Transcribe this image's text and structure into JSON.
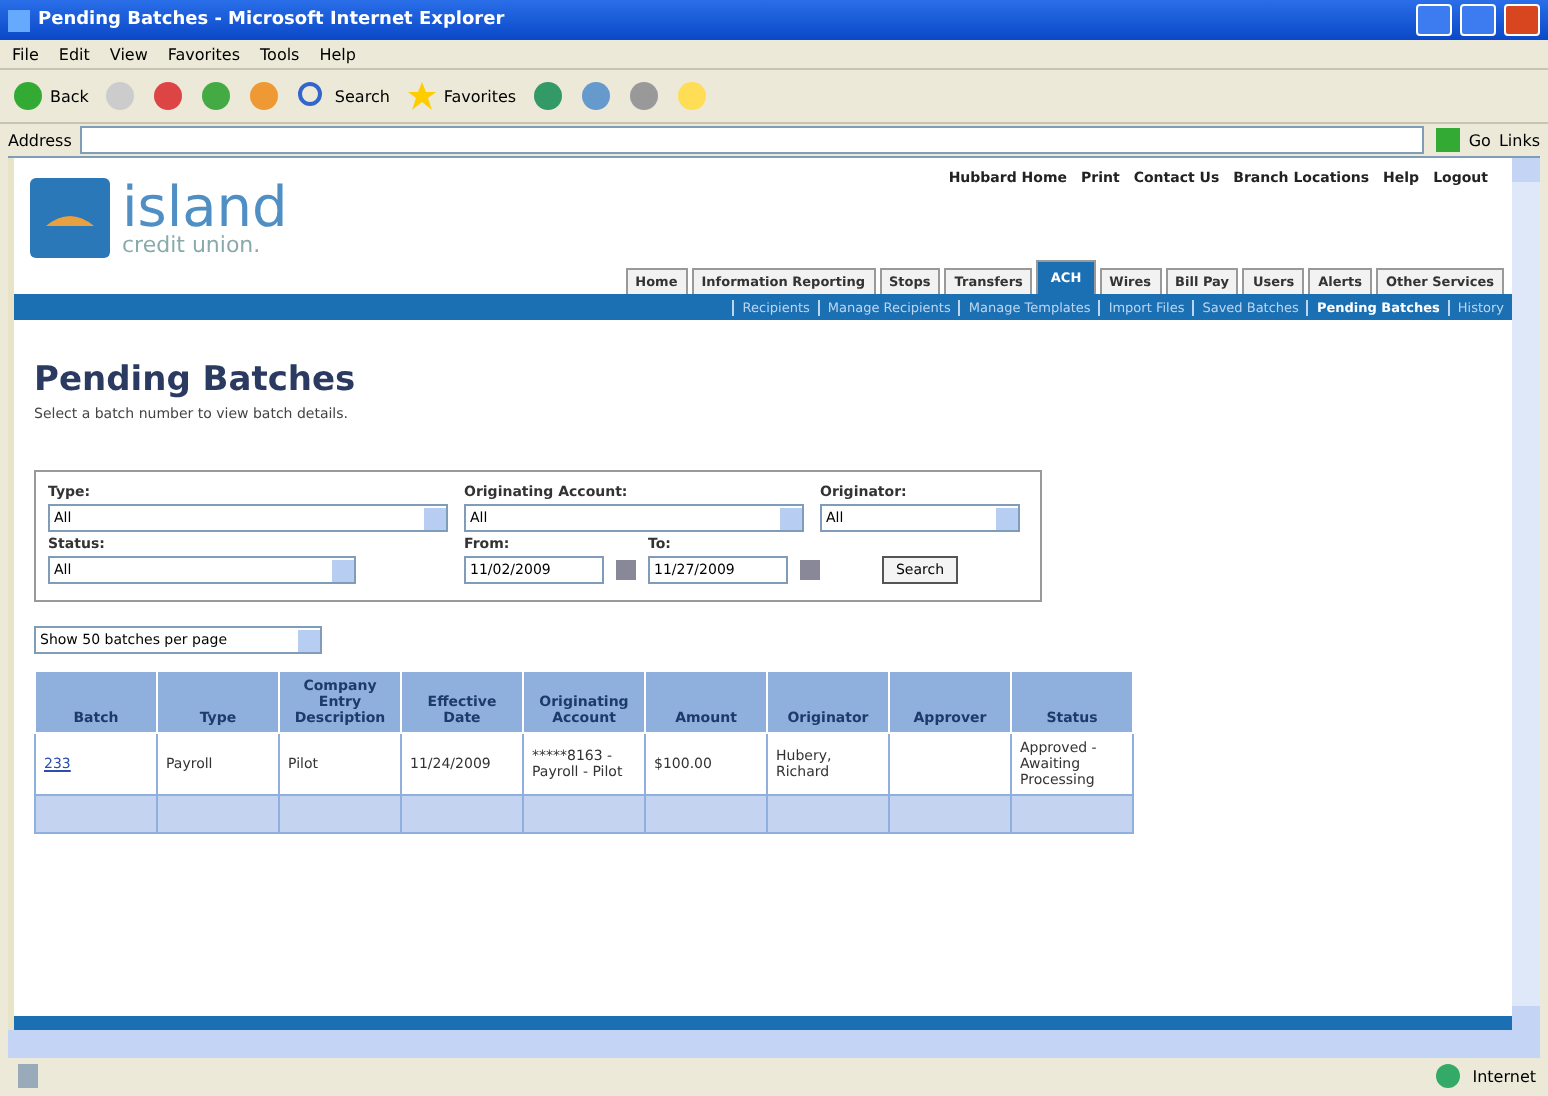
{
  "window": {
    "title": "Pending Batches - Microsoft Internet Explorer"
  },
  "menu": [
    "File",
    "Edit",
    "View",
    "Favorites",
    "Tools",
    "Help"
  ],
  "toolbar": {
    "back": "Back",
    "search": "Search",
    "favorites": "Favorites"
  },
  "address_bar": {
    "label": "Address",
    "go": "Go",
    "links": "Links"
  },
  "site": {
    "logo_name": "island",
    "logo_sub": "credit union.",
    "top_links": [
      "Hubbard Home",
      "Print",
      "Contact Us",
      "Branch Locations",
      "Help",
      "Logout"
    ],
    "tabs": [
      {
        "label": "Home",
        "selected": false
      },
      {
        "label": "Information Reporting",
        "selected": false
      },
      {
        "label": "Stops",
        "selected": false
      },
      {
        "label": "Transfers",
        "selected": false
      },
      {
        "label": "ACH",
        "selected": true
      },
      {
        "label": "Wires",
        "selected": false
      },
      {
        "label": "Bill Pay",
        "selected": false
      },
      {
        "label": "Users",
        "selected": false
      },
      {
        "label": "Alerts",
        "selected": false
      },
      {
        "label": "Other Services",
        "selected": false
      }
    ],
    "subnav": [
      {
        "label": "Recipients",
        "selected": false
      },
      {
        "label": "Manage Recipients",
        "selected": false
      },
      {
        "label": "Manage Templates",
        "selected": false
      },
      {
        "label": "Import Files",
        "selected": false
      },
      {
        "label": "Saved Batches",
        "selected": false
      },
      {
        "label": "Pending Batches",
        "selected": true
      },
      {
        "label": "History",
        "selected": false
      }
    ]
  },
  "page": {
    "title": "Pending Batches",
    "subtitle": "Select a batch number to view batch details.",
    "filters": {
      "type": {
        "label": "Type:",
        "value": "All"
      },
      "account": {
        "label": "Originating Account:",
        "value": "All"
      },
      "originator": {
        "label": "Originator:",
        "value": "All"
      },
      "status": {
        "label": "Status:",
        "value": "All"
      },
      "from": {
        "label": "From:",
        "value": "11/02/2009"
      },
      "to": {
        "label": "To:",
        "value": "11/27/2009"
      },
      "search": "Search"
    },
    "per_page": "Show 50 batches per page",
    "table": {
      "columns": [
        "Batch",
        "Type",
        "Company Entry Description",
        "Effective Date",
        "Originating Account",
        "Amount",
        "Originator",
        "Approver",
        "Status"
      ],
      "rows": [
        [
          "233",
          "Payroll",
          "Pilot",
          "11/24/2009",
          "*****8163 - Payroll - Pilot",
          "$100.00",
          "Hubery, Richard",
          "",
          "Approved - Awaiting Processing"
        ]
      ]
    }
  },
  "status_bar": {
    "zone": "Internet"
  }
}
